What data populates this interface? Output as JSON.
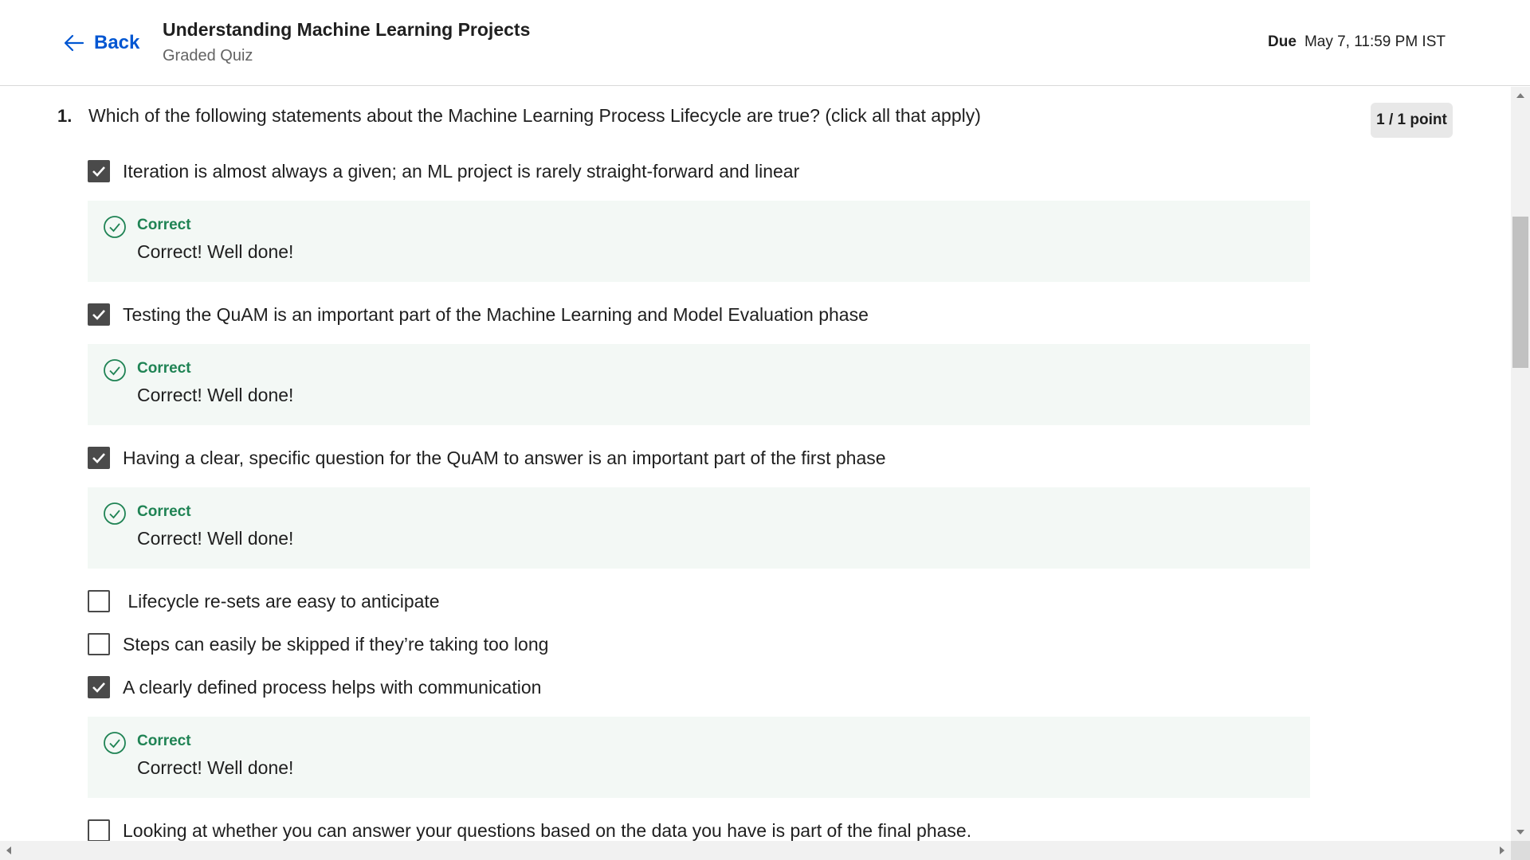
{
  "header": {
    "back_label": "Back",
    "course_title": "Understanding Machine Learning Projects",
    "subtitle": "Graded Quiz",
    "due_label": "Due",
    "due_value": "May 7, 11:59 PM IST"
  },
  "question": {
    "number": "1.",
    "text": "Which of the following statements about the Machine Learning Process Lifecycle are true? (click all that apply)",
    "points": "1 / 1 point"
  },
  "options": [
    {
      "label": "Iteration is almost always a given; an ML project is rarely straight-forward and linear",
      "checked": true
    },
    {
      "label": "Testing the QuAM is an important part of the Machine Learning and Model Evaluation phase",
      "checked": true
    },
    {
      "label": "Having a clear, specific question for the QuAM to answer is an important part of the first phase",
      "checked": true
    },
    {
      "label": " Lifecycle re-sets are easy to anticipate",
      "checked": false
    },
    {
      "label": "Steps can easily be skipped if they’re taking too long",
      "checked": false
    },
    {
      "label": "A clearly defined process helps with communication",
      "checked": true
    },
    {
      "label": "Looking at whether you can answer your questions based on the data you have is part of the final phase.",
      "checked": false
    }
  ],
  "feedback": {
    "label": "Correct",
    "text": "Correct! Well done!"
  },
  "colors": {
    "accent": "#0056d2",
    "correct_green": "#1f8354",
    "feedback_bg": "#f3f8f5"
  }
}
